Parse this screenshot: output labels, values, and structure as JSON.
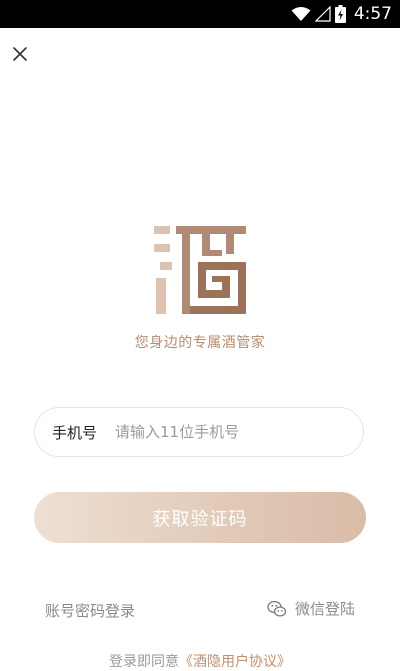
{
  "status_bar": {
    "time": "4:57",
    "icons": [
      "wifi-icon",
      "cell-signal-icon",
      "battery-charging-icon"
    ]
  },
  "header": {
    "close_icon": "close-icon"
  },
  "brand": {
    "logo_icon": "jiu-logo-icon",
    "tagline": "您身边的专属酒管家",
    "colors": {
      "brand": "#b48c72",
      "logo_light": "#ddc2b0",
      "logo_dark": "#9c7358"
    }
  },
  "login_form": {
    "phone_label": "手机号",
    "phone_value": "",
    "phone_placeholder": "请输入11位手机号",
    "submit_label": "获取验证码",
    "submit_gradient": [
      "#eedfd3",
      "#d9bca8"
    ]
  },
  "alt_login": {
    "password_login": "账号密码登录",
    "wechat_login": "微信登陆",
    "wechat_icon": "wechat-icon"
  },
  "agreement": {
    "prefix": "登录即同意",
    "link": "《酒隐用户协议》"
  }
}
